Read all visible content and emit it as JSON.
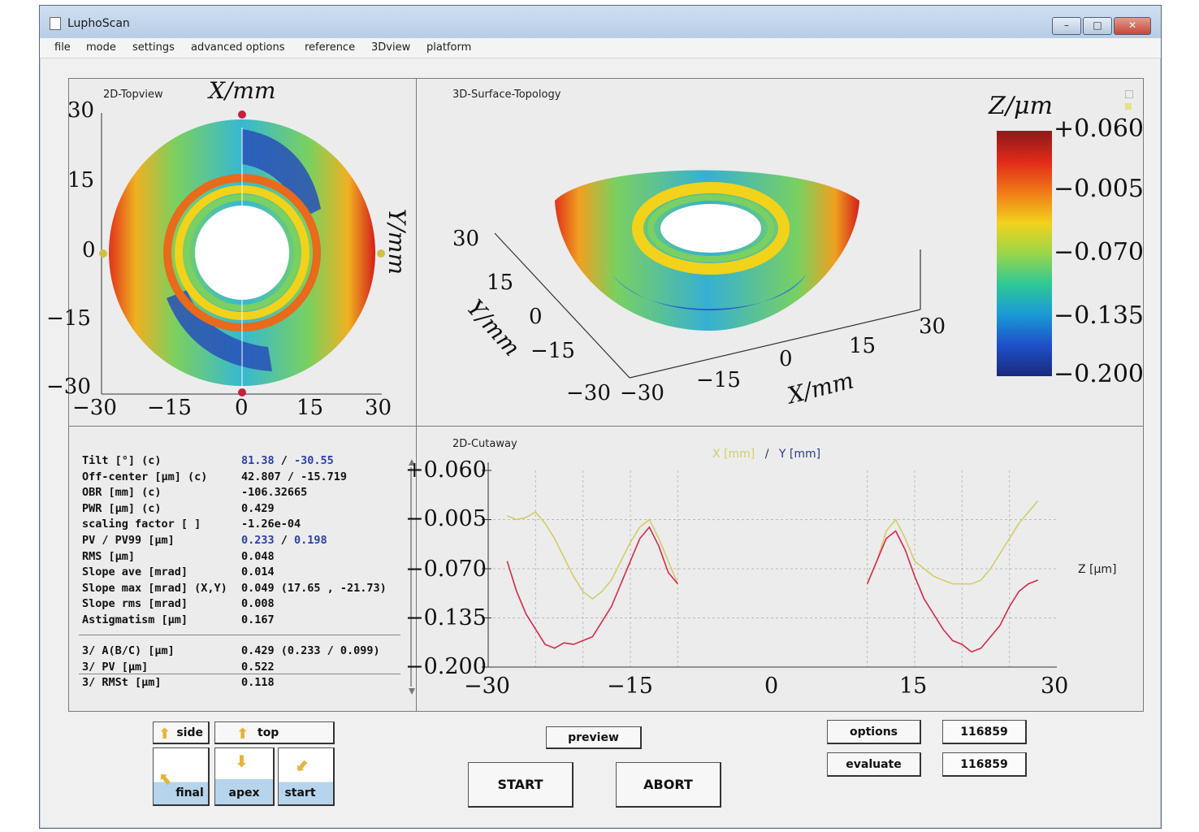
{
  "window": {
    "title": "LuphoScan"
  },
  "menu": [
    "file",
    "mode",
    "settings",
    "advanced options",
    "reference",
    "3Dview",
    "platform"
  ],
  "topview": {
    "title": "2D-Topview",
    "x_axis_name": "X/mm",
    "y_axis_name": "Y/mm",
    "x_ticks": [
      "−30",
      "−15",
      "0",
      "15",
      "30"
    ],
    "y_ticks": [
      "30",
      "15",
      "0",
      "−15",
      "−30"
    ]
  },
  "surface3d": {
    "title": "3D-Surface-Topology",
    "y_axis_name": "Y/mm",
    "x_axis_name": "X/mm",
    "y_ticks": [
      "30",
      "15",
      "0",
      "−15",
      "−30"
    ],
    "x_ticks": [
      "−30",
      "−15",
      "0",
      "15",
      "30"
    ]
  },
  "colorbar": {
    "title": "Z/μm",
    "labels": [
      "+0.060",
      "−0.005",
      "−0.070",
      "−0.135",
      "−0.200"
    ],
    "stops": [
      "#8c1a1a",
      "#e02a1a",
      "#f07a18",
      "#f2d21a",
      "#9ad64a",
      "#2ec896",
      "#1a9ad6",
      "#1e4fc8",
      "#1a2a7c"
    ]
  },
  "stats": {
    "rows": [
      {
        "label": "Tilt [°]  (c)",
        "value": "81.38",
        "value2": "-30.55",
        "sep": " / "
      },
      {
        "label": "Off-center [μm]  (c)",
        "value": "42.807 / -15.719"
      },
      {
        "label": "OBR [mm]  (c)",
        "value": "-106.32665"
      },
      {
        "label": "PWR [μm]  (c)",
        "value": "0.429"
      },
      {
        "label": "scaling factor [ ]",
        "value": "-1.26e-04"
      },
      {
        "label": "PV / PV99 [μm]",
        "value": "0.233",
        "value2": "0.198",
        "sep": " / "
      },
      {
        "label": "RMS [μm]",
        "value": "0.048"
      },
      {
        "label": "Slope ave [mrad]",
        "value": "0.014"
      },
      {
        "label": "Slope max [mrad] (X,Y)",
        "value": "0.049  (17.65 , -21.73)"
      },
      {
        "label": "Slope rms [mrad]",
        "value": "0.008"
      },
      {
        "label": "Astigmatism [μm]",
        "value": "0.167"
      }
    ],
    "rows2": [
      {
        "label": "3/ A(B/C) [μm]",
        "value": "0.429 (0.233 / 0.099)"
      },
      {
        "label": "3/ PV [μm]",
        "value": "0.522"
      },
      {
        "label": "3/ RMSt [μm]",
        "value": "0.118"
      }
    ]
  },
  "cutaway": {
    "title": "2D-Cutaway",
    "legend_x": "X [mm]",
    "legend_sep": "/",
    "legend_y": "Y [mm]",
    "z_label": "Z [μm]",
    "y_ticks": [
      "+0.060",
      "−0.005",
      "−0.070",
      "−0.135",
      "−0.200"
    ],
    "x_ticks": [
      "−30",
      "−15",
      "0",
      "15",
      "30"
    ],
    "colors": {
      "x": "#d4cc6a",
      "y": "#d42a4a"
    }
  },
  "chart_data": {
    "type": "line",
    "xlim": [
      -30,
      30
    ],
    "ylim": [
      -0.2,
      0.06
    ],
    "xlabel": "",
    "ylabel": "Z [μm]",
    "grid": true,
    "series": [
      {
        "name": "X [mm]",
        "x": [
          -28,
          -27,
          -26,
          -25,
          -24,
          -23,
          -22,
          -21,
          -20,
          -19,
          -18,
          -17,
          -16,
          -15,
          -14,
          -13,
          -12,
          -11,
          -10,
          null,
          10,
          11,
          12,
          13,
          14,
          15,
          16,
          17,
          18,
          19,
          20,
          21,
          22,
          23,
          24,
          25,
          26,
          27,
          28
        ],
        "y": [
          0.0,
          -0.005,
          -0.002,
          0.005,
          -0.01,
          -0.03,
          -0.055,
          -0.08,
          -0.1,
          -0.11,
          -0.1,
          -0.085,
          -0.06,
          -0.035,
          -0.015,
          -0.005,
          -0.03,
          -0.06,
          -0.09,
          null,
          -0.09,
          -0.06,
          -0.02,
          -0.005,
          -0.03,
          -0.06,
          -0.07,
          -0.08,
          -0.085,
          -0.09,
          -0.09,
          -0.09,
          -0.085,
          -0.07,
          -0.05,
          -0.03,
          -0.01,
          0.005,
          0.02
        ]
      },
      {
        "name": "Y [mm]",
        "x": [
          -28,
          -27,
          -26,
          -25,
          -24,
          -23,
          -22,
          -21,
          -20,
          -19,
          -18,
          -17,
          -16,
          -15,
          -14,
          -13,
          -12,
          -11,
          -10,
          null,
          10,
          11,
          12,
          13,
          14,
          15,
          16,
          17,
          18,
          19,
          20,
          21,
          22,
          23,
          24,
          25,
          26,
          27,
          28
        ],
        "y": [
          -0.06,
          -0.1,
          -0.13,
          -0.15,
          -0.17,
          -0.175,
          -0.168,
          -0.17,
          -0.165,
          -0.16,
          -0.14,
          -0.12,
          -0.09,
          -0.06,
          -0.03,
          -0.015,
          -0.04,
          -0.075,
          -0.09,
          null,
          -0.09,
          -0.06,
          -0.03,
          -0.02,
          -0.045,
          -0.08,
          -0.11,
          -0.13,
          -0.15,
          -0.165,
          -0.17,
          -0.18,
          -0.175,
          -0.16,
          -0.145,
          -0.12,
          -0.1,
          -0.09,
          -0.085
        ]
      }
    ]
  },
  "controls": {
    "side": "side",
    "top": "top",
    "final": "final",
    "apex": "apex",
    "start": "start",
    "preview": "preview",
    "start_btn": "START",
    "abort_btn": "ABORT",
    "options": "options",
    "evaluate": "evaluate",
    "field1": "116859",
    "field2": "116859"
  }
}
